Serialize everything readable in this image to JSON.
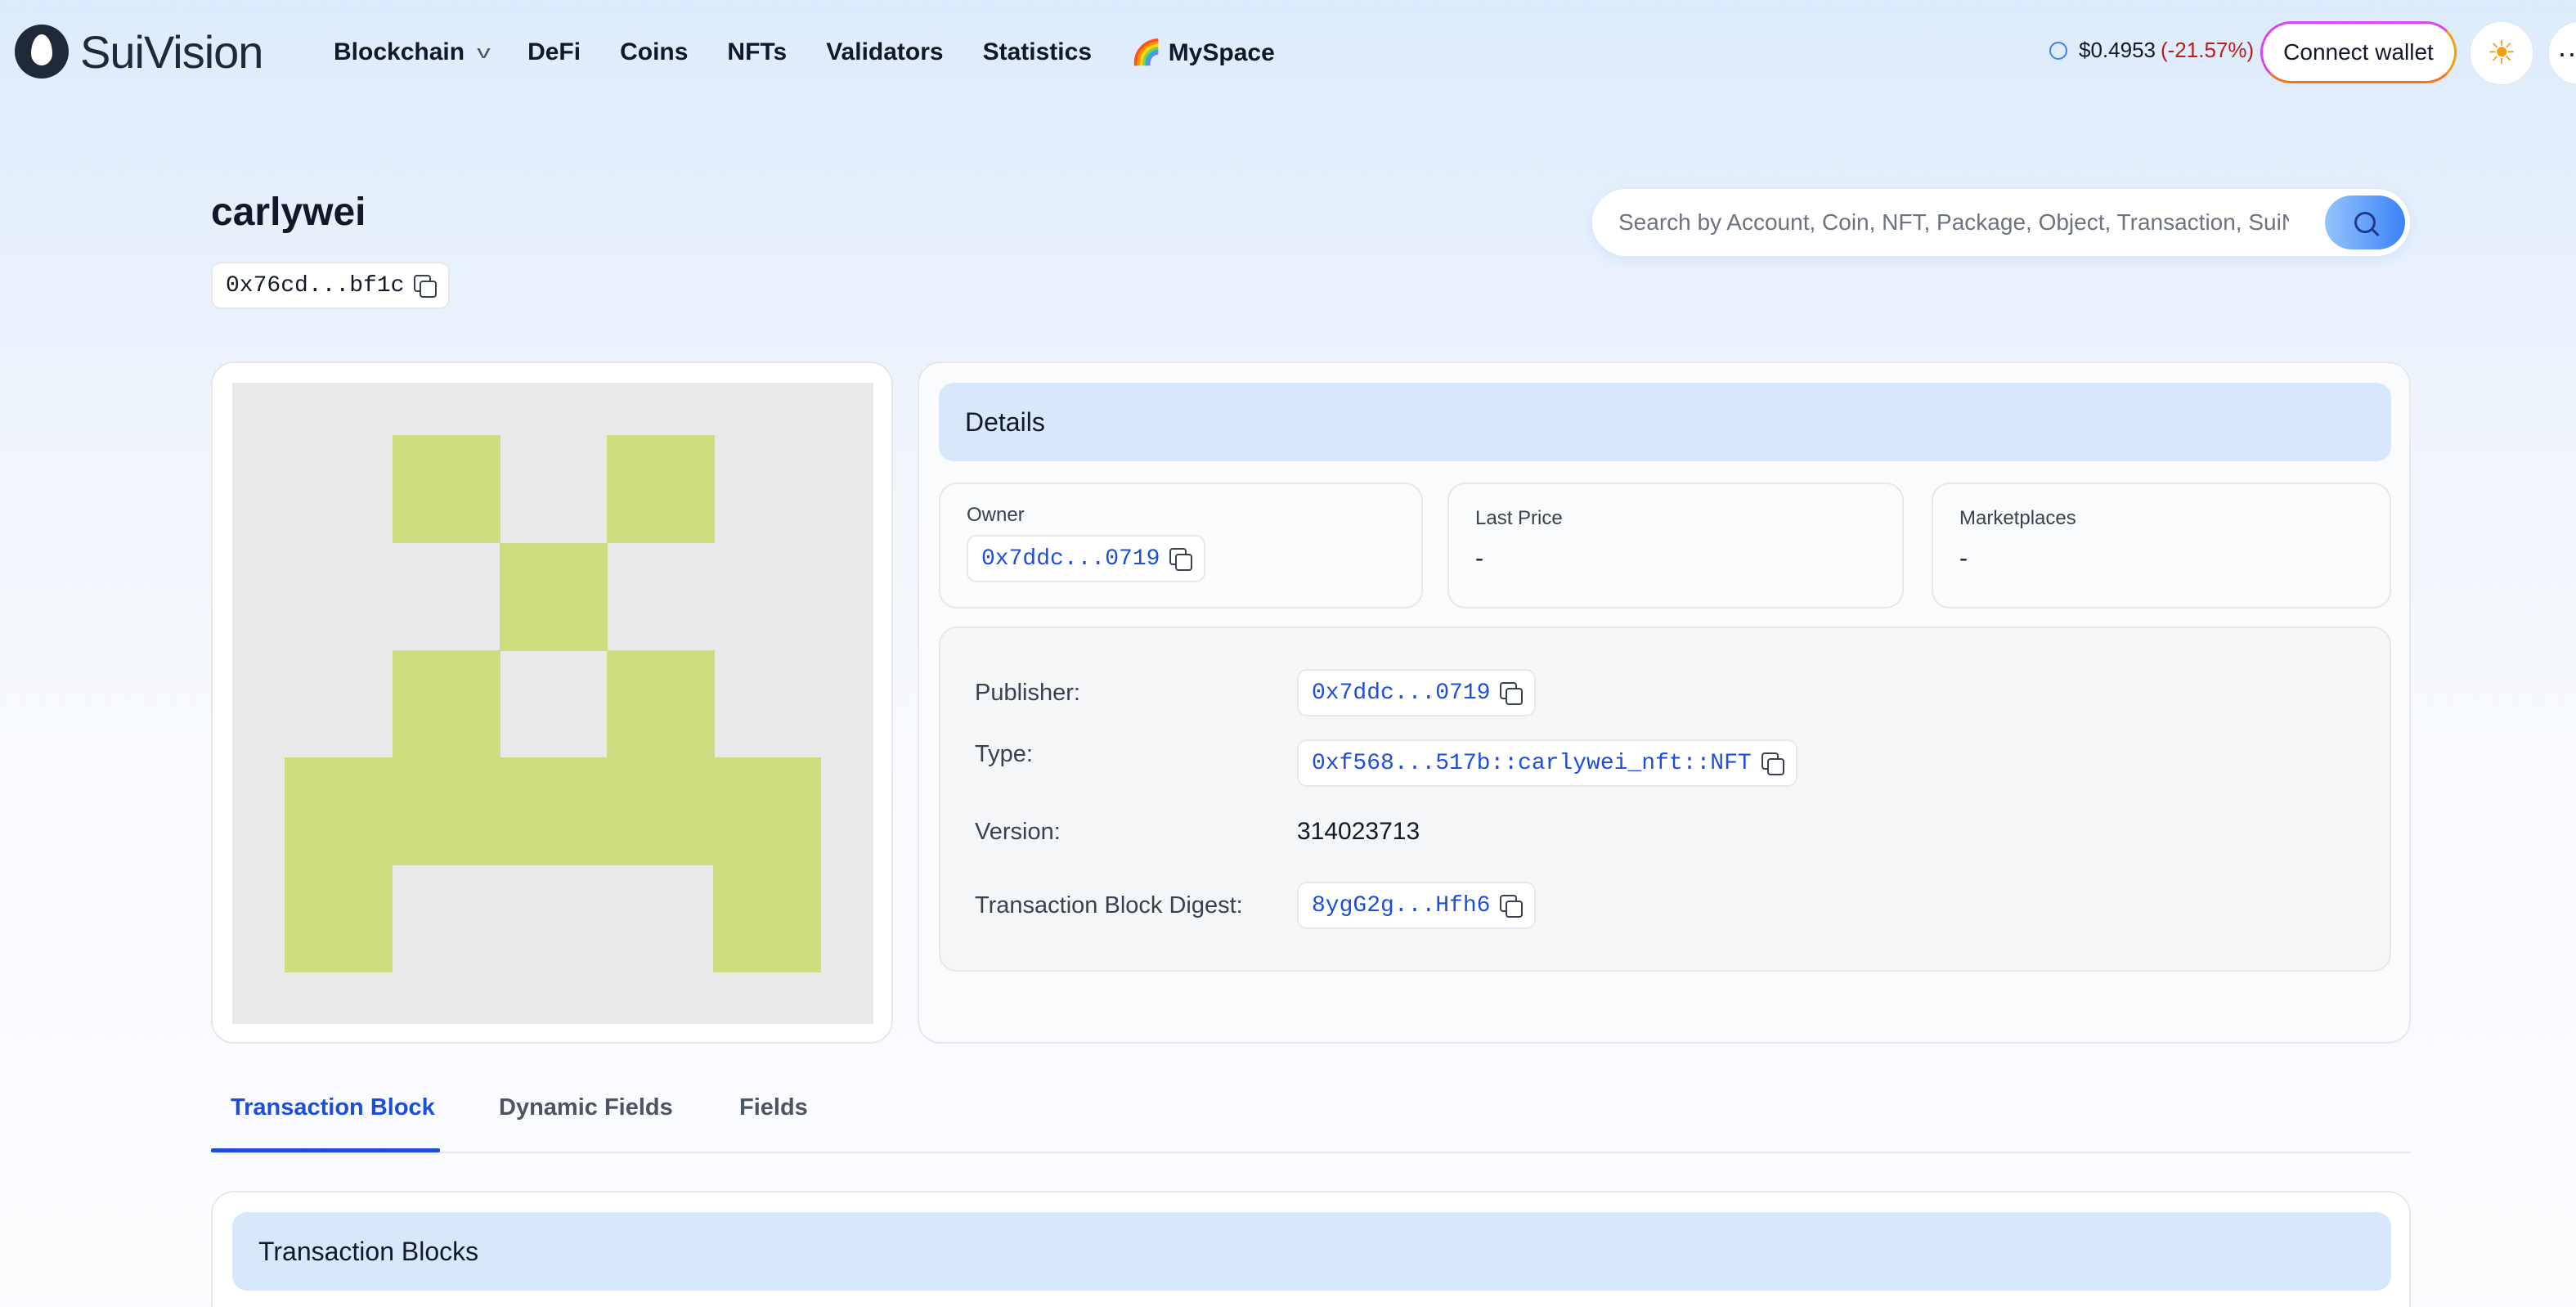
{
  "brand": {
    "name": "SuiVision"
  },
  "nav": {
    "items": [
      {
        "label": "Blockchain",
        "has_dropdown": true
      },
      {
        "label": "DeFi"
      },
      {
        "label": "Coins"
      },
      {
        "label": "NFTs"
      },
      {
        "label": "Validators"
      },
      {
        "label": "Statistics"
      },
      {
        "label": "🌈 MySpace"
      }
    ]
  },
  "ticker": {
    "price": "$0.4953",
    "change": "(-21.57%)",
    "change_color": "#b91c1c"
  },
  "header": {
    "connect_label": "Connect wallet",
    "theme_icon": "sun-icon",
    "more_icon": "more-icon"
  },
  "page": {
    "title": "carlywei",
    "address": "0x76cd...bf1c"
  },
  "search": {
    "placeholder": "Search by Account, Coin, NFT, Package, Object, Transaction, SuiNS"
  },
  "nft_image": {
    "background": "#e9e9e9",
    "fill": "#cddc7e"
  },
  "details": {
    "heading": "Details",
    "owner_label": "Owner",
    "owner_value": "0x7ddc...0719",
    "last_price_label": "Last Price",
    "last_price_value": "-",
    "marketplaces_label": "Marketplaces",
    "marketplaces_value": "-",
    "rows": {
      "publisher": {
        "label": "Publisher:",
        "value": "0x7ddc...0719"
      },
      "type": {
        "label": "Type:",
        "value": "0xf568...517b::carlywei_nft::NFT"
      },
      "version": {
        "label": "Version:",
        "value": "314023713"
      },
      "digest": {
        "label": "Transaction Block Digest:",
        "value": "8ygG2g...Hfh6"
      }
    }
  },
  "tabs": [
    {
      "label": "Transaction Block",
      "active": true
    },
    {
      "label": "Dynamic Fields",
      "active": false
    },
    {
      "label": "Fields",
      "active": false
    }
  ],
  "tx_section": {
    "heading": "Transaction Blocks"
  },
  "colors": {
    "accent": "#1d4ed8",
    "panel_header": "#d8e8fc"
  }
}
